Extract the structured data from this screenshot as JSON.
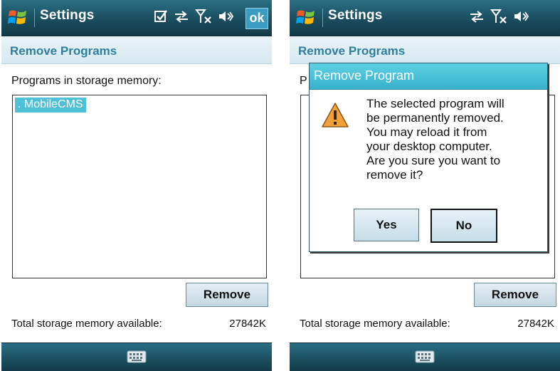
{
  "screens": [
    {
      "title": "Settings",
      "header": "Remove Programs",
      "section_label": "Programs in storage memory:",
      "list_items": [
        ". MobileCMS"
      ],
      "remove_button": "Remove",
      "storage_label": "Total storage memory available:",
      "storage_value": "27842K",
      "ok_label": "ok"
    },
    {
      "title": "Settings",
      "header": "Remove Programs",
      "section_label": "P",
      "remove_button": "Remove",
      "storage_label": "Total storage memory available:",
      "storage_value": "27842K"
    }
  ],
  "dialog": {
    "title": "Remove Program",
    "message": "The selected program will\nbe permanently removed.\nYou may reload it from\nyour desktop computer.\nAre you sure you want to\nremove it?",
    "yes_label": "Yes",
    "no_label": "No"
  },
  "colors": {
    "titlebar": "#1a4d5e",
    "header_text": "#2f7f9c",
    "selection": "#4fc1d6",
    "dialog_title": "#36b2cc"
  },
  "icons": [
    "windows-start-icon",
    "checklist-icon",
    "sync-arrows-icon",
    "no-signal-icon",
    "speaker-icon",
    "keyboard-icon",
    "warning-icon"
  ]
}
